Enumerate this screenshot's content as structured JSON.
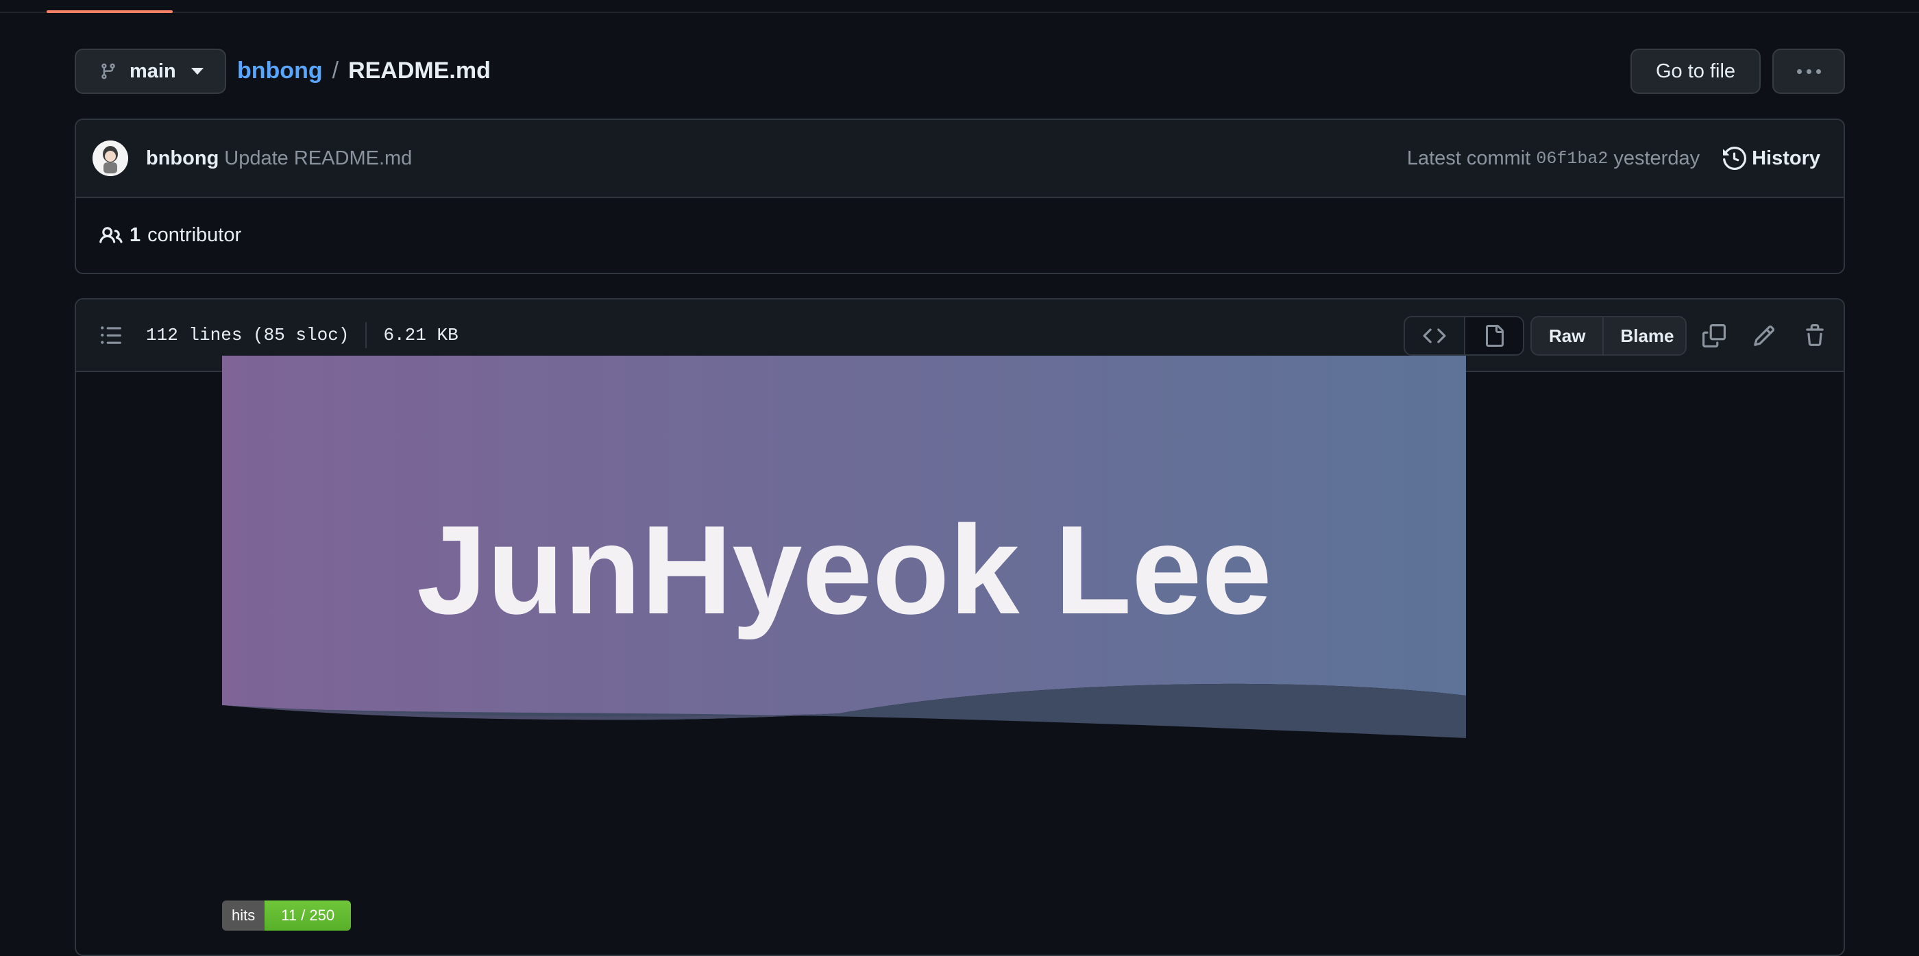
{
  "branch": {
    "label": "main"
  },
  "breadcrumb": {
    "owner": "bnbong",
    "separator": "/",
    "file": "README.md"
  },
  "header": {
    "goto_label": "Go to file"
  },
  "commit": {
    "author": "bnbong",
    "message": "Update README.md",
    "latest_prefix": "Latest commit",
    "sha": "06f1ba2",
    "time": "yesterday",
    "history_label": "History"
  },
  "contributors": {
    "count": "1",
    "label": "contributor"
  },
  "file": {
    "lines": "112 lines (85 sloc)",
    "size": "6.21 KB",
    "raw_label": "Raw",
    "blame_label": "Blame"
  },
  "readme": {
    "banner_title": "JunHyeok Lee",
    "hits_label": "hits",
    "hits_value": "11 / 250"
  },
  "colors": {
    "background": "#0d1117",
    "link": "#58a6ff",
    "banner_start": "#7e6497",
    "banner_end": "#5d7397",
    "badge_green": "#5cb531"
  }
}
